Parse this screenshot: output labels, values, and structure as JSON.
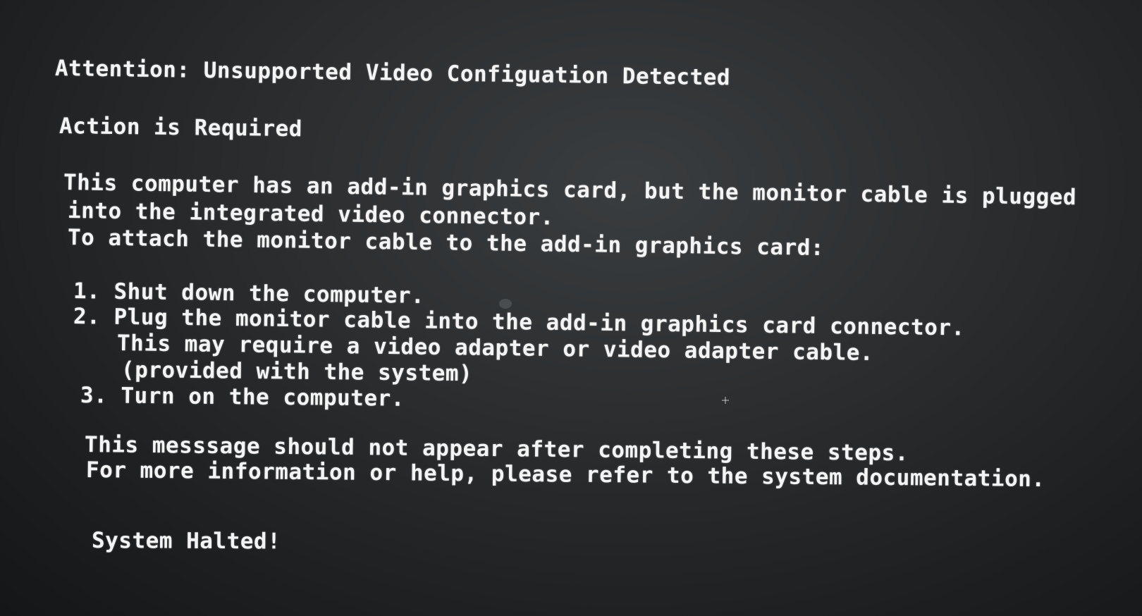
{
  "bios_message": {
    "title": "Attention: Unsupported Video Configuation Detected",
    "subtitle": "Action is Required",
    "paragraph_lines": [
      "This computer has an add-in graphics card, but the monitor cable is plugged",
      "into the integrated video connector.",
      "To attach the monitor cable to the add-in graphics card:"
    ],
    "steps": [
      "1. Shut down the computer.",
      "2. Plug the monitor cable into the add-in graphics card connector.",
      "This may require a video adapter or video adapter cable.",
      "(provided with the system)",
      "3. Turn on the computer."
    ],
    "closing_lines": [
      "This messsage should not appear after completing these steps.",
      "For more information or help, please refer to the system documentation."
    ],
    "status": "System Halted!"
  },
  "colors": {
    "text": "#f4f4f4",
    "background": "#2b2d2f"
  }
}
